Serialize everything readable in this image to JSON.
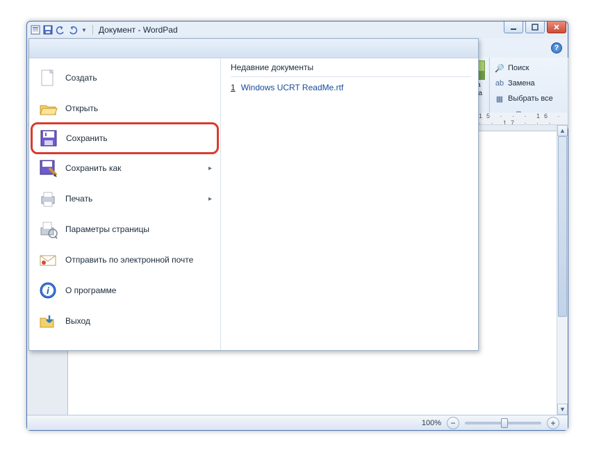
{
  "titlebar": {
    "title": "Документ - WordPad"
  },
  "file_menu": {
    "items": [
      {
        "label": "Создать"
      },
      {
        "label": "Открыть"
      },
      {
        "label": "Сохранить"
      },
      {
        "label": "Сохранить как",
        "has_submenu": true
      },
      {
        "label": "Печать",
        "has_submenu": true
      },
      {
        "label": "Параметры страницы"
      },
      {
        "label": "Отправить по электронной почте"
      },
      {
        "label": "О программе"
      },
      {
        "label": "Выход"
      }
    ],
    "recent_header": "Недавние документы",
    "recent": [
      {
        "num": "1",
        "name": "Windows UCRT ReadMe.rtf"
      }
    ]
  },
  "ribbon": {
    "insert_fragment": "вка\nекта",
    "editing": {
      "find": "Поиск",
      "replace": "Замена",
      "select_all": "Выбрать все",
      "group_label": "Правка"
    }
  },
  "ruler": {
    "ticks": "15 · · · 16 · · · 17 · · ·"
  },
  "statusbar": {
    "zoom_pct": "100%"
  }
}
